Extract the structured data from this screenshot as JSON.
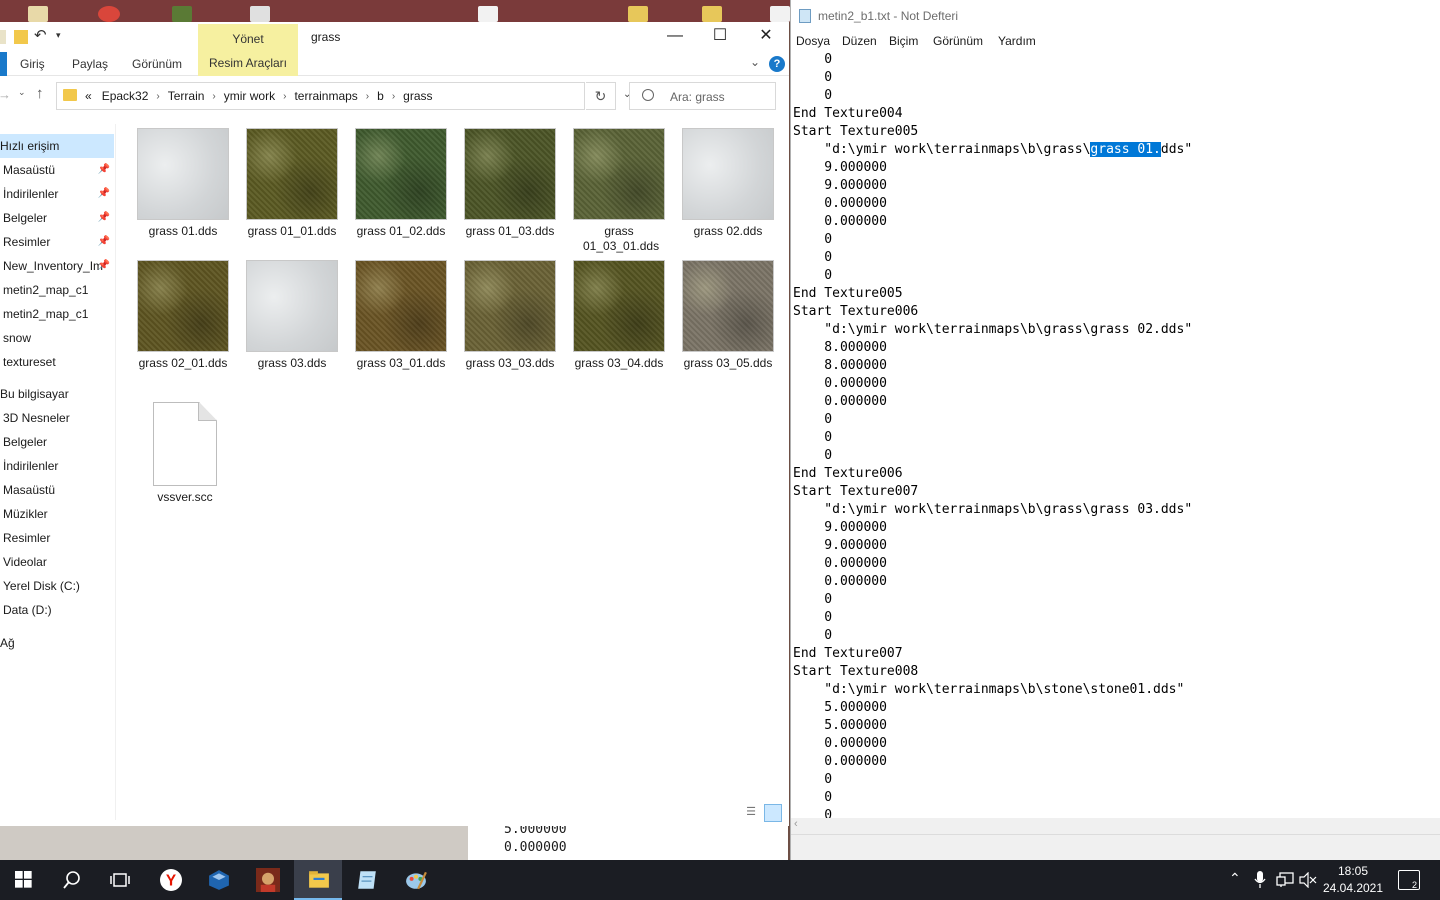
{
  "explorer": {
    "title": "grass",
    "tools_tab": "Yönet",
    "ribbon_tabs": [
      "Giriş",
      "Paylaş",
      "Görünüm",
      "Resim Araçları"
    ],
    "breadcrumb_prefix": "«",
    "breadcrumb": [
      "Epack32",
      "Terrain",
      "ymir work",
      "terrainmaps",
      "b",
      "grass"
    ],
    "search_placeholder": "Ara: grass",
    "nav_items": [
      "Hızlı erişim",
      "Masaüstü",
      "İndirilenler",
      "Belgeler",
      "Resimler",
      "New_Inventory_Im",
      "metin2_map_c1",
      "metin2_map_c1",
      "snow",
      "textureset",
      "Bu bilgisayar",
      "3D Nesneler",
      "Belgeler",
      "İndirilenler",
      "Masaüstü",
      "Müzikler",
      "Resimler",
      "Videolar",
      "Yerel Disk (C:)",
      "Data (D:)",
      "Ağ"
    ],
    "files": [
      {
        "name": "grass 01.dds",
        "color": "#d8dbdd"
      },
      {
        "name": "grass 01_01.dds",
        "color": "#5b5a22"
      },
      {
        "name": "grass 01_02.dds",
        "color": "#3f5a2e"
      },
      {
        "name": "grass 01_03.dds",
        "color": "#4c5526"
      },
      {
        "name": "grass 01_03_01.dds",
        "color": "#5a6336"
      },
      {
        "name": "grass 02.dds",
        "color": "#d8dbdd"
      },
      {
        "name": "grass 02_01.dds",
        "color": "#5e5521"
      },
      {
        "name": "grass 03.dds",
        "color": "#d8dbdd"
      },
      {
        "name": "grass 03_01.dds",
        "color": "#6a5424"
      },
      {
        "name": "grass 03_03.dds",
        "color": "#6a6235"
      },
      {
        "name": "grass 03_04.dds",
        "color": "#555421"
      },
      {
        "name": "grass 03_05.dds",
        "color": "#7b7466"
      },
      {
        "name": "vssver.scc",
        "color": "#ffffff"
      }
    ]
  },
  "notepad": {
    "title": "metin2_b1.txt - Not Defteri",
    "menus": [
      "Dosya",
      "Düzen",
      "Biçim",
      "Görünüm",
      "Yardım"
    ],
    "lines_before": "    0\n    0\n    0\nEnd Texture004\nStart Texture005\n    \"d:\\ymir work\\terrainmaps\\b\\grass\\",
    "selected_text": "grass 01.",
    "lines_after": "dds\"\n    9.000000\n    9.000000\n    0.000000\n    0.000000\n    0\n    0\n    0\nEnd Texture005\nStart Texture006\n    \"d:\\ymir work\\terrainmaps\\b\\grass\\grass 02.dds\"\n    8.000000\n    8.000000\n    0.000000\n    0.000000\n    0\n    0\n    0\nEnd Texture006\nStart Texture007\n    \"d:\\ymir work\\terrainmaps\\b\\grass\\grass 03.dds\"\n    9.000000\n    9.000000\n    0.000000\n    0.000000\n    0\n    0\n    0\nEnd Texture007\nStart Texture008\n    \"d:\\ymir work\\terrainmaps\\b\\stone\\stone01.dds\"\n    5.000000\n    5.000000\n    0.000000\n    0.000000\n    0\n    0\n    0"
  },
  "background_window": {
    "lines": [
      "5.000000",
      "0.000000"
    ]
  },
  "taskbar": {
    "time": "18:05",
    "date": "24.04.2021",
    "notification_count": "2",
    "apps": [
      "start-icon",
      "search-icon",
      "task-view-icon",
      "yandex-browser-icon",
      "virtualbox-icon",
      "game-icon",
      "file-explorer-icon",
      "notepad-icon",
      "paint-icon"
    ]
  }
}
